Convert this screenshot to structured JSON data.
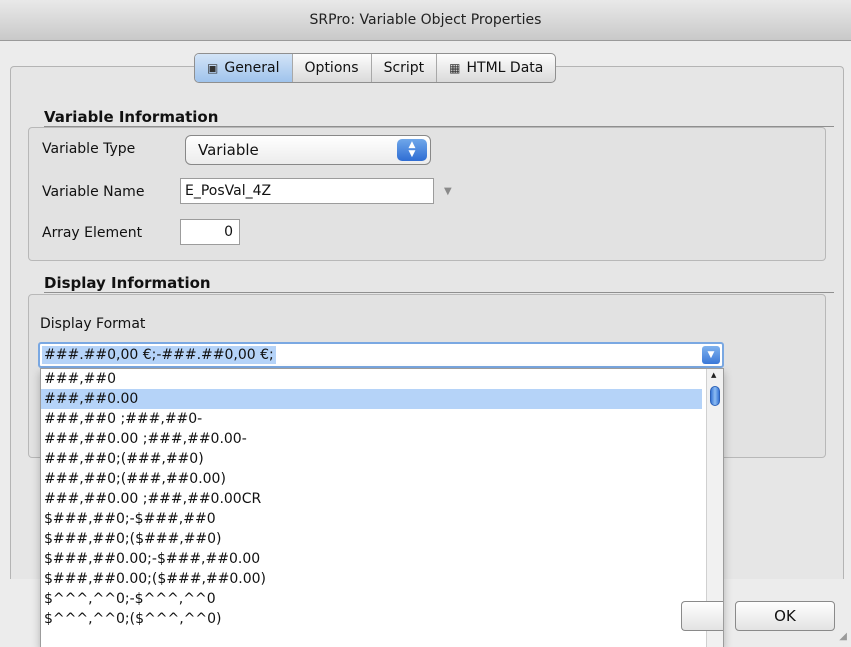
{
  "window": {
    "title": "SRPro: Variable Object Properties"
  },
  "tabs": [
    {
      "label": "General",
      "icon": "window-icon",
      "active": true
    },
    {
      "label": "Options"
    },
    {
      "label": "Script"
    },
    {
      "label": "HTML Data",
      "icon": "table-icon"
    }
  ],
  "variable_info": {
    "title": "Variable Information",
    "type_label": "Variable Type",
    "type_value": "Variable",
    "name_label": "Variable Name",
    "name_value": "E_PosVal_4Z",
    "array_label": "Array Element",
    "array_value": "0"
  },
  "display_info": {
    "title": "Display Information",
    "format_label": "Display Format",
    "format_value": "###.##0,00 €;-###.##0,00 €;",
    "options": [
      "###,##0",
      "###,##0.00",
      "###,##0 ;###,##0-",
      "###,##0.00 ;###,##0.00-",
      "###,##0;(###,##0)",
      "###,##0;(###,##0.00)",
      "###,##0.00 ;###,##0.00CR",
      "$###,##0;-$###,##0",
      "$###,##0;($###,##0)",
      "$###,##0.00;-$###,##0.00",
      "$###,##0.00;($###,##0.00)",
      "$^^^,^^0;-$^^^,^^0",
      "$^^^,^^0;($^^^,^^0)"
    ],
    "selected_index": 1
  },
  "buttons": {
    "ok": "OK"
  },
  "colors": {
    "selection": "#b5d3f8",
    "accent": "#3b78d8"
  }
}
